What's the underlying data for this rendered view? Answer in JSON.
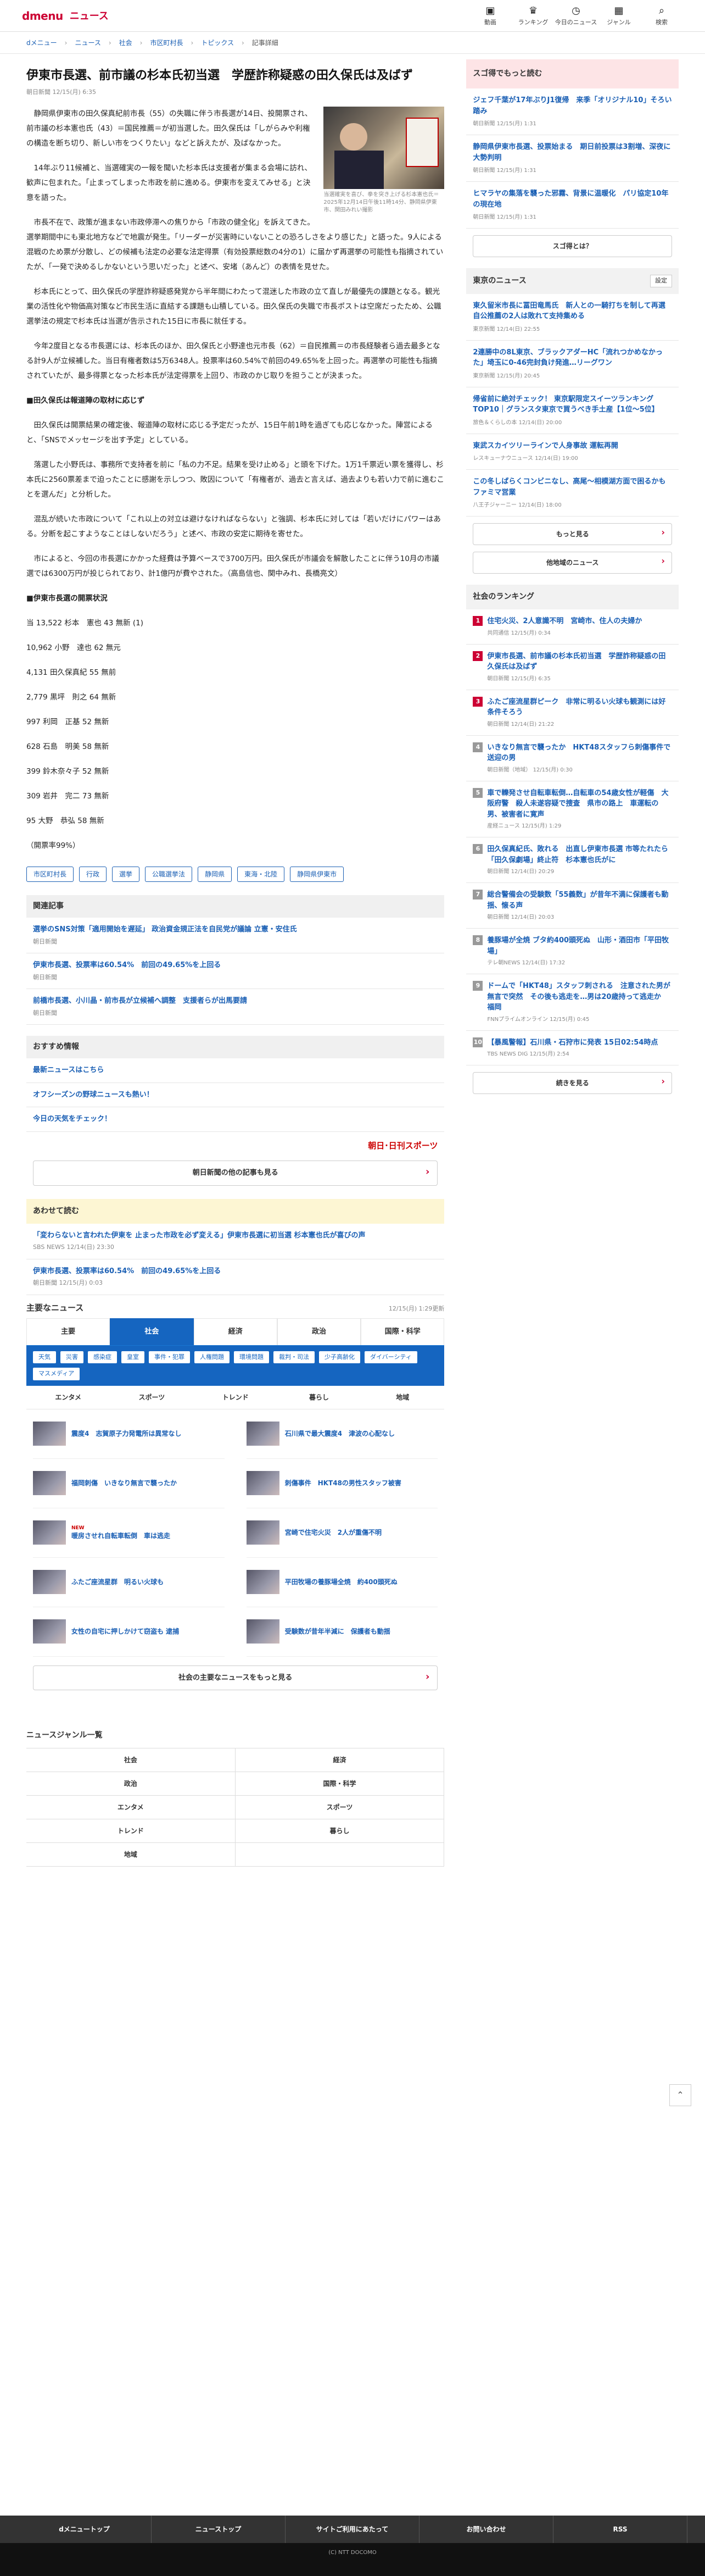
{
  "header": {
    "logo": "dmenu",
    "section": "ニュース",
    "nav": [
      {
        "icon": "▣",
        "label": "動画"
      },
      {
        "icon": "♛",
        "label": "ランキング"
      },
      {
        "icon": "◷",
        "label": "今日のニュース"
      },
      {
        "icon": "▦",
        "label": "ジャンル"
      },
      {
        "icon": "⌕",
        "label": "検索"
      }
    ]
  },
  "breadcrumb": [
    "dメニュー",
    "ニュース",
    "社会",
    "市区町村長",
    "トピックス",
    "記事詳細"
  ],
  "article": {
    "title": "伊東市長選、前市議の杉本氏初当選　学歴詐称疑惑の田久保氏は及ばず",
    "date": "朝日新聞 12/15(月) 6:35",
    "photo_caption": "当選確実を喜び、拳を突き上げる杉本憲也氏＝2025年12月14日午後11時14分、静岡県伊東市、関田みれい撮影",
    "paragraphs": [
      "静岡県伊東市の田久保真紀前市長（55）の失職に伴う市長選が14日、投開票され、前市議の杉本憲也氏（43）＝国民推薦＝が初当選した。田久保氏は「しがらみや利権の構造を断ち切り、新しい市をつくりたい」などと訴えたが、及ばなかった。",
      "14年ぶり11候補と、当選確実の一報を聞いた杉本氏は支援者が集まる会場に訪れ、歓声に包まれた。「止まってしまった市政を前に進める。伊東市を変えてみせる」と決意を語った。",
      "市長不在で、政策が進まない市政停滞への焦りから「市政の健全化」を訴えてきた。選挙期間中にも東北地方などで地震が発生。「リーダーが災害時にいないことの恐ろしさをより感じた」と語った。9人による混戦のため票が分散し、どの候補も法定の必要な法定得票（有効投票総数の4分の1）に届かず再選挙の可能性も指摘されていたが、「一発で決めるしかないという思いだった」と述べ、安堵（あんど）の表情を見せた。",
      "杉本氏にとって、田久保氏の学歴詐称疑惑発覚から半年間にわたって混迷した市政の立て直しが最優先の課題となる。観光業の活性化や物価高対策など市民生活に直結する課題も山積している。田久保氏の失職で市長ポストは空席だったため、公職選挙法の規定で杉本氏は当選が告示された15日に市長に就任する。",
      "今年2度目となる市長選には、杉本氏のほか、田久保氏と小野達也元市長（62）＝自民推薦＝の市長経験者ら過去最多となる計9人が立候補した。当日有権者数は5万6348人。投票率は60.54%で前回の49.65%を上回った。再選挙の可能性も指摘されていたが、最多得票となった杉本氏が法定得票を上回り、市政のかじ取りを担うことが決まった。"
    ],
    "sub1": "■田久保氏は報道陣の取材に応じず",
    "paragraphs2": [
      "田久保氏は開票結果の確定後、報道陣の取材に応じる予定だったが、15日午前1時を過ぎても応じなかった。陣営によると、「SNSでメッセージを出す予定」としている。",
      "落選した小野氏は、事務所で支持者を前に「私の力不足。結果を受け止める」と頭を下げた。1万1千票近い票を獲得し、杉本氏に2560票差まで迫ったことに感謝を示しつつ、敗因について「有権者が、過去と言えば、過去よりも若い力で前に進むことを選んだ」と分析した。",
      "混乱が続いた市政について「これ以上の対立は避けなければならない」と強調、杉本氏に対しては「若いだけにパワーはある。分断を起こすようなことはしないだろう」と述べ、市政の安定に期待を寄せた。",
      "市によると、今回の市長選にかかった経費は予算ベースで3700万円。田久保氏が市議会を解散したことに伴う10月の市議選では6300万円が投じられており、計1億円が費やされた。（高島信也、関中みれ、長橋亮文）"
    ],
    "sub2": "■伊東市長選の開票状況",
    "results": [
      "当 13,522 杉本　憲也 43 無新 (1)",
      "10,962 小野　達也 62 無元",
      "4,131 田久保真紀 55 無前",
      "2,779 黒坪　則之 64 無新",
      "997 利岡　正基 52 無新",
      "628 石島　明美 58 無新",
      "399 鈴木奈々子 52 無新",
      "309 岩井　完二 73 無新",
      "95 大野　恭弘 58 無新",
      "（開票率99%）"
    ],
    "tags": [
      "市区町村長",
      "行政",
      "選挙",
      "公職選挙法",
      "静岡県",
      "東海・北陸",
      "静岡県伊東市"
    ]
  },
  "related": {
    "heading": "関連記事",
    "items": [
      {
        "title": "選挙のSNS対策「適用開始を遅延」 政治資金規正法を自民党が議論 立憲・安住氏",
        "source": "朝日新聞"
      },
      {
        "title": "伊東市長選、投票率は60.54%　前回の49.65%を上回る",
        "source": "朝日新聞"
      },
      {
        "title": "前橋市長選、小川晶・前市長が立候補へ調整　支援者らが出馬要請",
        "source": "朝日新聞"
      }
    ]
  },
  "recommend": {
    "heading": "おすすめ情報",
    "items": [
      "最新ニュースはこちら",
      "オフシーズンの野球ニュースも熱い！",
      "今日の天気をチェック！"
    ],
    "logo": "朝日･日刊スポーツ",
    "more": "朝日新聞の他の記事も見る"
  },
  "also": {
    "heading": "あわせて読む",
    "items": [
      {
        "title": "「変わらないと言われた伊東を 止まった市政を必ず変える」伊東市長選に初当選 杉本憲也氏が喜びの声",
        "source": "SBS NEWS 12/14(日) 23:30"
      },
      {
        "title": "伊東市長選、投票率は60.54%　前回の49.65%を上回る",
        "source": "朝日新聞 12/15(月) 0:03"
      }
    ]
  },
  "main_news": {
    "heading": "主要なニュース",
    "updated": "12/15(月) 1:29更新",
    "tabs": [
      "主要",
      "社会",
      "経済",
      "政治",
      "国際・科学"
    ],
    "subtags": [
      "天気",
      "災害",
      "感染症",
      "皇室",
      "事件・犯罪",
      "人権問題",
      "環境問題",
      "裁判・司法",
      "少子高齢化",
      "ダイバーシティ",
      "マスメディア"
    ],
    "subtabs": [
      "エンタメ",
      "スポーツ",
      "トレンド",
      "暮らし",
      "地域"
    ],
    "items": [
      {
        "t": "震度4　志賀原子力発電所は異常なし",
        "new": ""
      },
      {
        "t": "石川県で最大震度4　津波の心配なし",
        "new": ""
      },
      {
        "t": "福岡刺傷　いきなり無言で襲ったか",
        "new": ""
      },
      {
        "t": "刺傷事件　HKT48の男性スタッフ被害",
        "new": ""
      },
      {
        "t": "暖房させれ自転車転倒　車は逃走",
        "new": "NEW"
      },
      {
        "t": "宮崎で住宅火災　2人が重傷不明",
        "new": ""
      },
      {
        "t": "ふたご座流星群　明るい火球も",
        "new": ""
      },
      {
        "t": "平田牧場の養豚場全焼　約400頭死ぬ",
        "new": ""
      },
      {
        "t": "女性の自宅に押しかけて窃盗も 逮捕",
        "new": ""
      },
      {
        "t": "受験数が昔年半減に　保護者も動揺",
        "new": ""
      }
    ],
    "more": "社会の主要なニュースをもっと見る"
  },
  "genre": {
    "heading": "ニュースジャンル一覧",
    "items": [
      "社会",
      "経済",
      "政治",
      "国際・科学",
      "エンタメ",
      "スポーツ",
      "トレンド",
      "暮らし",
      "地域",
      ""
    ]
  },
  "side": {
    "suggo": {
      "heading": "スゴ得でもっと読む",
      "items": [
        {
          "t": "ジェフ千葉が17年ぶりJ1復帰　来季「オリジナル10」そろい踏み",
          "s": "朝日新聞 12/15(月) 1:31"
        },
        {
          "t": "静岡県伊東市長選、投票始まる　期日前投票は3割増、深夜に大勢判明",
          "s": "朝日新聞 12/15(月) 1:31"
        },
        {
          "t": "ヒマラヤの集落を襲った邪霧、背景に温暖化　パリ協定10年の現在地",
          "s": "朝日新聞 12/15(月) 1:31"
        }
      ],
      "btn": "スゴ得とは？"
    },
    "tokyo": {
      "heading": "東京のニュース",
      "set": "設定",
      "items": [
        {
          "t": "東久留米市長に冨田竜馬氏　新人との一騎打ちを制して再選　自公推薦の2人は敗れて支持集める",
          "s": "東京新聞 12/14(日) 22:55"
        },
        {
          "t": "2連勝中の8L東京、ブラックアダーHC「流れつかめなかった」埼玉に0-46完封負け発進…リーグワン",
          "s": "東京新聞 12/15(月) 20:45"
        },
        {
          "t": "帰省前に絶対チェック！ 東京駅限定スイーツランキングTOP10｜グランスタ東京で買うべき手土産【1位〜5位】",
          "s": "旅色＆くらしの本 12/14(日) 20:00"
        },
        {
          "t": "東武スカイツリーラインで人身事故 運転再開",
          "s": "レスキューナウニュース 12/14(日) 19:00"
        },
        {
          "t": "この冬しばらくコンビニなし、高尾〜相模湖方面で困るかもファミマ営業",
          "s": "八王子ジャーニー 12/14(日) 18:00"
        }
      ],
      "more": "もっと見る",
      "other": "他地域のニュース"
    },
    "ranking": {
      "heading": "社会のランキング",
      "items": [
        {
          "n": "1",
          "t": "住宅火災、2人意識不明　宮崎市、住人の夫婦か",
          "s": "共同通信 12/15(月) 0:34"
        },
        {
          "n": "2",
          "t": "伊東市長選、前市議の杉本氏初当選　学歴詐称疑惑の田久保氏は及ばず",
          "s": "朝日新聞 12/15(月) 6:35"
        },
        {
          "n": "3",
          "t": "ふたご座流星群ピーク　非常に明るい火球も観測には好条件そろう",
          "s": "朝日新聞 12/14(日) 21:22"
        },
        {
          "n": "4",
          "t": "いきなり無言で襲ったか　HKT48スタッフら刺傷事件で送迎の男",
          "s": "朝日新聞（地域） 12/15(月) 0:30"
        },
        {
          "n": "5",
          "t": "車で轢発させ自転車転倒…自転車の54歳女性が軽傷　大阪府警　殺人未遂容疑で捜査　県市の路上　車運転の男、被害者に寛声",
          "s": "産経ニュース 12/15(月) 1:29"
        },
        {
          "n": "6",
          "t": "田久保真紀氏、敗れる　出直し伊東市長選 市等たれたら「田久保劇場」終止符　杉本憲也氏がに",
          "s": "朝日新聞 12/14(日) 20:29"
        },
        {
          "n": "7",
          "t": "総合警備会の受験数「55義数」が昔年不満に保護者も動揺、懐る声",
          "s": "朝日新聞 12/14(日) 20:03"
        },
        {
          "n": "8",
          "t": "養豚場が全焼 ブタ約400頭死ぬ　山形・酒田市「平田牧場」",
          "s": "テレ朝NEWS 12/14(日) 17:32"
        },
        {
          "n": "9",
          "t": "ドームで「HKT48」スタッフ刺される　注意された男が無言で突然　その後も逃走を…男は20歳持って逃走か　福岡",
          "s": "FNNプライムオンライン 12/15(月) 0:45"
        },
        {
          "n": "10",
          "t": "【暴風警報】石川県・石狩市に発表 15日02:54時点",
          "s": "TBS NEWS DIG 12/15(月) 2:54"
        }
      ],
      "more": "続きを見る"
    }
  },
  "footer": {
    "links": [
      "dメニュートップ",
      "ニューストップ",
      "サイトご利用にあたって",
      "お問い合わせ",
      "RSS"
    ],
    "copyright": "(C) NTT DOCOMO"
  }
}
